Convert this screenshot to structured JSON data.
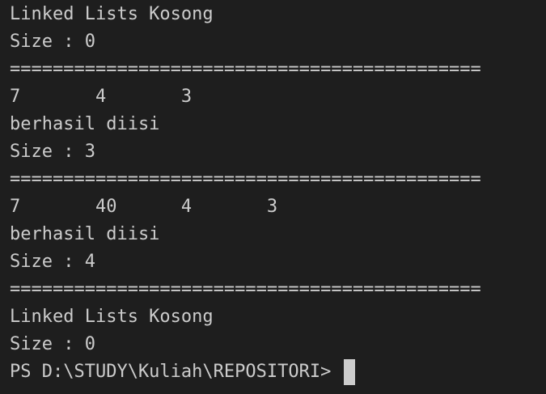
{
  "terminal": {
    "lines": [
      "Linked Lists Kosong",
      "Size : 0",
      "============================================",
      "7       4       3",
      "berhasil diisi",
      "Size : 3",
      "============================================",
      "7       40      4       3",
      "berhasil diisi",
      "Size : 4",
      "============================================",
      "Linked Lists Kosong",
      "Size : 0"
    ],
    "prompt": "PS D:\\STUDY\\Kuliah\\REPOSITORI>"
  },
  "colors": {
    "background": "#1e1e1e",
    "foreground": "#cccccc",
    "cursor": "#cccccc"
  }
}
